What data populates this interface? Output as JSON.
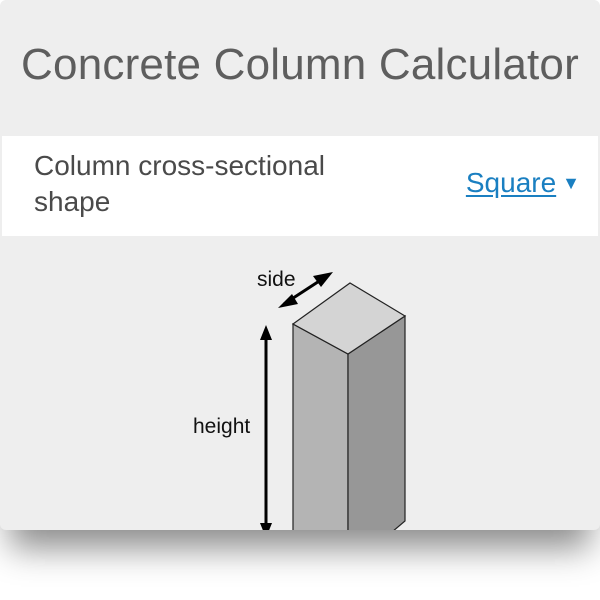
{
  "title": "Concrete Column Calculator",
  "field": {
    "label": "Column cross-sectional shape",
    "selected_value": "Square",
    "caret_icon": "triangle-down"
  },
  "diagram": {
    "side_label": "side",
    "height_label": "height"
  },
  "colors": {
    "card_background": "#eeeeee",
    "title_text": "#5e5e5e",
    "link_blue": "#1a7fc1",
    "column_front": "#b4b4b4",
    "column_side": "#979797",
    "column_top": "#d4d4d4"
  }
}
